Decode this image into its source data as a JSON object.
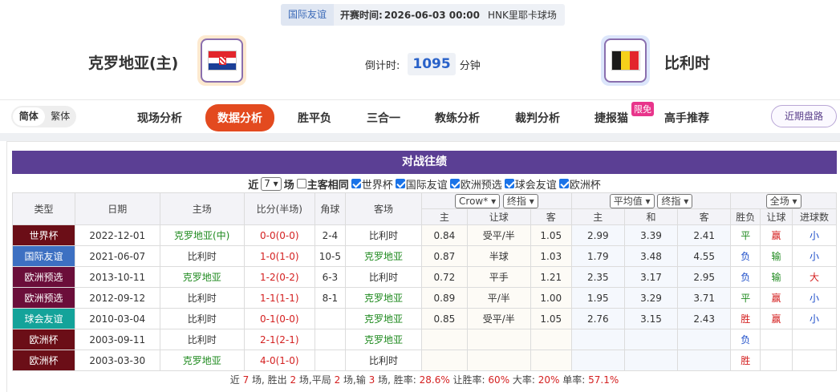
{
  "header": {
    "competition": "国际友谊",
    "kickoff_label": "开赛时间:",
    "kickoff_time": "2026-06-03 00:00",
    "venue": "HNK里耶卡球场",
    "home_team": "克罗地亚(主)",
    "away_team": "比利时",
    "countdown_label": "倒计时:",
    "countdown_value": "1095",
    "countdown_unit": "分钟"
  },
  "nav": {
    "lang_simplified": "简体",
    "lang_traditional": "繁体",
    "items": [
      "现场分析",
      "数据分析",
      "胜平负",
      "三合一",
      "教练分析",
      "裁判分析",
      "捷报猫",
      "高手推荐"
    ],
    "badge": "限免",
    "recent_button": "近期盘路"
  },
  "panel": {
    "title": "对战往绩",
    "filter_prefix": "近",
    "filter_count": "7",
    "filter_unit": "场",
    "same_home_away": "主客相同",
    "competitions": [
      "世界杯",
      "国际友谊",
      "欧洲预选",
      "球会友谊",
      "欧洲杯"
    ]
  },
  "table": {
    "headers": {
      "type": "类型",
      "date": "日期",
      "home": "主场",
      "score": "比分(半场)",
      "corners": "角球",
      "away": "客场",
      "company": "Crow*",
      "handicap_mode": "终指",
      "euro_mode": "平均值",
      "euro_stage": "终指",
      "scope": "全场",
      "h_home": "主",
      "h_line": "让球",
      "h_away": "客",
      "e_home": "主",
      "e_draw": "和",
      "e_away": "客",
      "result": "胜负",
      "h_result": "让球",
      "goals": "进球数"
    },
    "rows": [
      {
        "type": "世界杯",
        "date": "2022-12-01",
        "home": "克罗地亚(中)",
        "score": "0-0(0-0)",
        "corners": "2-4",
        "away": "比利时",
        "hh": "0.84",
        "hl": "受平/半",
        "ha": "1.05",
        "eh": "2.99",
        "ed": "3.39",
        "ea": "2.41",
        "res": "平",
        "hres": "赢",
        "goals": "小"
      },
      {
        "type": "国际友谊",
        "date": "2021-06-07",
        "home": "比利时",
        "score": "1-0(1-0)",
        "corners": "10-5",
        "away": "克罗地亚",
        "hh": "0.87",
        "hl": "半球",
        "ha": "1.03",
        "eh": "1.79",
        "ed": "3.48",
        "ea": "4.55",
        "res": "负",
        "hres": "输",
        "goals": "小"
      },
      {
        "type": "欧洲预选",
        "date": "2013-10-11",
        "home": "克罗地亚",
        "score": "1-2(0-2)",
        "corners": "6-3",
        "away": "比利时",
        "hh": "0.72",
        "hl": "平手",
        "ha": "1.21",
        "eh": "2.35",
        "ed": "3.17",
        "ea": "2.95",
        "res": "负",
        "hres": "输",
        "goals": "大"
      },
      {
        "type": "欧洲预选",
        "date": "2012-09-12",
        "home": "比利时",
        "score": "1-1(1-1)",
        "corners": "8-1",
        "away": "克罗地亚",
        "hh": "0.89",
        "hl": "平/半",
        "ha": "1.00",
        "eh": "1.95",
        "ed": "3.29",
        "ea": "3.71",
        "res": "平",
        "hres": "赢",
        "goals": "小"
      },
      {
        "type": "球会友谊",
        "date": "2010-03-04",
        "home": "比利时",
        "score": "0-1(0-0)",
        "corners": "",
        "away": "克罗地亚",
        "hh": "0.85",
        "hl": "受平/半",
        "ha": "1.05",
        "eh": "2.76",
        "ed": "3.15",
        "ea": "2.43",
        "res": "胜",
        "hres": "赢",
        "goals": "小"
      },
      {
        "type": "欧洲杯",
        "date": "2003-09-11",
        "home": "比利时",
        "score": "2-1(2-1)",
        "corners": "",
        "away": "克罗地亚",
        "hh": "",
        "hl": "",
        "ha": "",
        "eh": "",
        "ed": "",
        "ea": "",
        "res": "负",
        "hres": "",
        "goals": ""
      },
      {
        "type": "欧洲杯",
        "date": "2003-03-30",
        "home": "克罗地亚",
        "score": "4-0(1-0)",
        "corners": "",
        "away": "比利时",
        "hh": "",
        "hl": "",
        "ha": "",
        "eh": "",
        "ed": "",
        "ea": "",
        "res": "胜",
        "hres": "",
        "goals": ""
      }
    ]
  },
  "summary": {
    "t1": "近 ",
    "games": "7",
    "t2": " 场, 胜出 ",
    "wins": "2",
    "t3": " 场,平局 ",
    "draws": "2",
    "t4": " 场,输 ",
    "losses": "3",
    "t5": " 场, 胜率: ",
    "win_rate": "28.6%",
    "t6": " 让胜率: ",
    "hcap_rate": "60%",
    "t7": " 大率: ",
    "over_rate": "20%",
    "t8": " 单率: ",
    "odd_rate": "57.1%"
  },
  "colors": {
    "accent_purple": "#5b3f94",
    "nav_active": "#e34a1f",
    "win_red": "#d42020",
    "draw_green": "#1f8a1f",
    "loss_blue": "#1c4dc9"
  }
}
